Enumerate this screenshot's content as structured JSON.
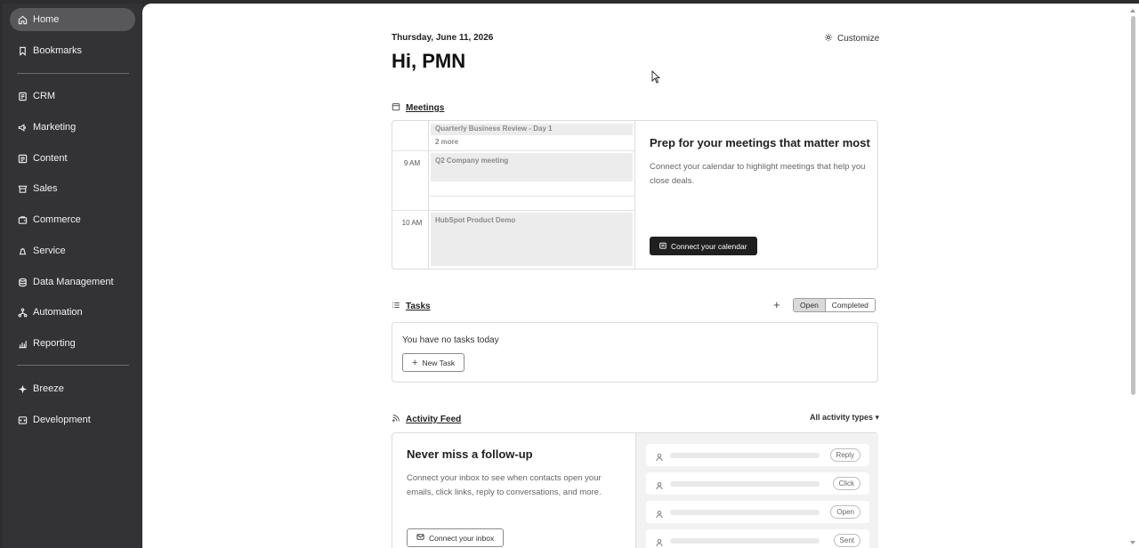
{
  "sidebar": {
    "items": [
      {
        "label": "Home",
        "icon": "home-icon"
      },
      {
        "label": "Bookmarks",
        "icon": "bookmark-icon"
      },
      {
        "label": "CRM",
        "icon": "crm-icon"
      },
      {
        "label": "Marketing",
        "icon": "megaphone-icon"
      },
      {
        "label": "Content",
        "icon": "content-icon"
      },
      {
        "label": "Sales",
        "icon": "sales-icon"
      },
      {
        "label": "Commerce",
        "icon": "commerce-icon"
      },
      {
        "label": "Service",
        "icon": "service-icon"
      },
      {
        "label": "Data Management",
        "icon": "database-icon"
      },
      {
        "label": "Automation",
        "icon": "automation-icon"
      },
      {
        "label": "Reporting",
        "icon": "chart-icon"
      },
      {
        "label": "Breeze",
        "icon": "sparkle-icon"
      },
      {
        "label": "Development",
        "icon": "code-icon"
      }
    ],
    "active": "Home"
  },
  "header": {
    "date": "Thursday, June 11, 2026",
    "greeting": "Hi, PMN",
    "customize_label": "Customize"
  },
  "meetings": {
    "title": "Meetings",
    "events": [
      {
        "title": "Quarterly Business Review - Day 1",
        "more": "2 more"
      },
      {
        "time": "9 AM",
        "title": "Q2 Company meeting"
      },
      {
        "time": "10 AM",
        "title": "HubSpot Product Demo"
      }
    ],
    "prep_title": "Prep for your meetings that matter most",
    "prep_desc": "Connect your calendar to highlight meetings that help you close deals.",
    "connect_button": "Connect your calendar"
  },
  "tasks": {
    "title": "Tasks",
    "add_label": "+",
    "tabs": [
      "Open",
      "Completed"
    ],
    "active_tab": "Open",
    "empty_text": "You have no tasks today",
    "new_task_button": "New Task"
  },
  "activity": {
    "title": "Activity Feed",
    "filter_label": "All activity types ▾",
    "promo_title": "Never miss a follow-up",
    "promo_desc": "Connect your inbox to see when contacts open your emails, click links, reply to conversations, and more.",
    "connect_button": "Connect your inbox",
    "rows": [
      "Reply",
      "Click",
      "Open",
      "Sent"
    ]
  },
  "colors": {
    "sidebar_bg": "#333335",
    "active_item_bg": "#58585a",
    "primary_button": "#1f1f1f"
  }
}
